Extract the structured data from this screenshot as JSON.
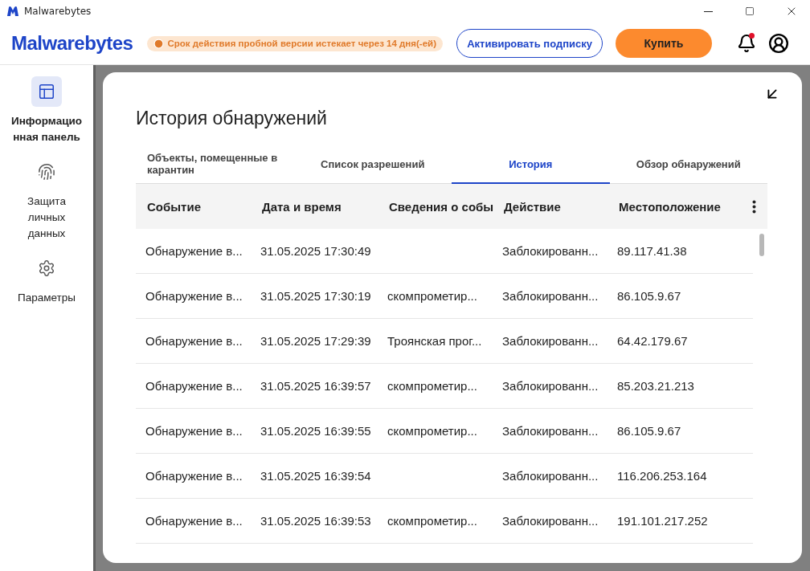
{
  "window": {
    "title": "Malwarebytes"
  },
  "header": {
    "logo": "Malwarebytes",
    "trial_notice": "Срок действия пробной версии истекает через 14 дня(-ей)",
    "activate_button": "Активировать подписку",
    "buy_button": "Купить",
    "notifications_unread": true
  },
  "sidebar": {
    "items": [
      {
        "label": "Информационная панель",
        "selected": true
      },
      {
        "label": "Защита личных данных",
        "selected": false
      },
      {
        "label": "Параметры",
        "selected": false
      }
    ]
  },
  "panel": {
    "title": "История обнаружений",
    "tabs": [
      {
        "label": "Объекты, помещенные в карантин",
        "selected": false
      },
      {
        "label": "Список разрешений",
        "selected": false
      },
      {
        "label": "История",
        "selected": true
      },
      {
        "label": "Обзор обнаружений",
        "selected": false
      }
    ],
    "table": {
      "columns": [
        "Событие",
        "Дата и время",
        "Сведения о собы",
        "Действие",
        "Местоположение"
      ],
      "rows": [
        [
          "Обнаружение в...",
          "31.05.2025 17:30:49",
          "",
          "Заблокированн...",
          "89.117.41.38"
        ],
        [
          "Обнаружение в...",
          "31.05.2025 17:30:19",
          "скомпрометир...",
          "Заблокированн...",
          "86.105.9.67"
        ],
        [
          "Обнаружение в...",
          "31.05.2025 17:29:39",
          "Троянская прог...",
          "Заблокированн...",
          "64.42.179.67"
        ],
        [
          "Обнаружение в...",
          "31.05.2025 16:39:57",
          "скомпрометир...",
          "Заблокированн...",
          "85.203.21.213"
        ],
        [
          "Обнаружение в...",
          "31.05.2025 16:39:55",
          "скомпрометир...",
          "Заблокированн...",
          "86.105.9.67"
        ],
        [
          "Обнаружение в...",
          "31.05.2025 16:39:54",
          "",
          "Заблокированн...",
          "116.206.253.164"
        ],
        [
          "Обнаружение в...",
          "31.05.2025 16:39:53",
          "скомпрометир...",
          "Заблокированн...",
          "191.101.217.252"
        ]
      ]
    }
  }
}
